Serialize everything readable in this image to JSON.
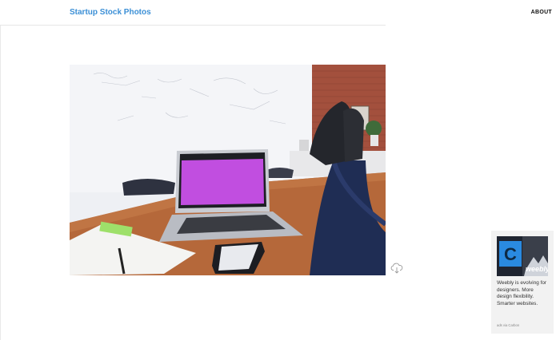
{
  "header": {
    "site_title": "Startup Stock Photos",
    "nav_about": "ABOUT"
  },
  "photo": {
    "icon": "stock-photo-laptop-desk"
  },
  "download": {
    "icon": "cloud-download-icon"
  },
  "ad": {
    "image_letter": "C",
    "image_brand": "weebly",
    "text": "Weebly is evolving for designers. More design flexibility. Smarter websites.",
    "via": "ads via Carbon"
  },
  "colors": {
    "accent": "#3b8fd6",
    "ad_bg": "#f2f2f2",
    "ad_blue": "#2a8ae0"
  }
}
